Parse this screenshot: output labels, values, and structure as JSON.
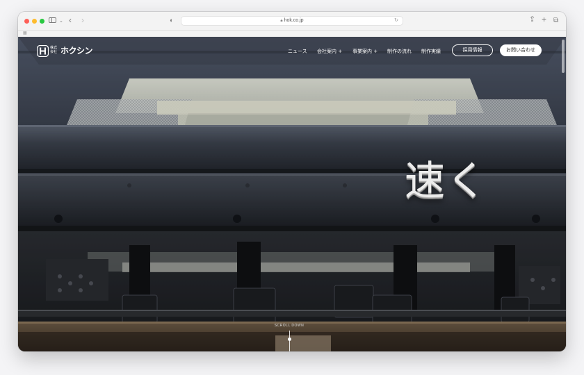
{
  "browser": {
    "url": "hok.co.jp"
  },
  "site": {
    "logo_small": "株式\n会社",
    "logo_name": "ホクシン"
  },
  "nav": {
    "items": [
      {
        "label": "ニュース"
      },
      {
        "label": "会社案内 +"
      },
      {
        "label": "事業案内 +"
      },
      {
        "label": "制作の流れ"
      },
      {
        "label": "制作実績"
      }
    ],
    "recruit_button": "採用情報",
    "contact_button": "お問い合わせ"
  },
  "hero": {
    "heading": "速く",
    "scroll_label": "SCROLL DOWN"
  },
  "colors": {
    "close": "#fe5f57",
    "minimize": "#febc2e",
    "maximize": "#28c840",
    "nav_text": "#ffffff"
  },
  "icons": [
    "shield-icon",
    "lock-icon",
    "reload-icon",
    "share-icon",
    "plus-icon",
    "tabs-icon",
    "chevron-left-icon",
    "chevron-right-icon",
    "sidebar-icon",
    "grid-icon"
  ]
}
